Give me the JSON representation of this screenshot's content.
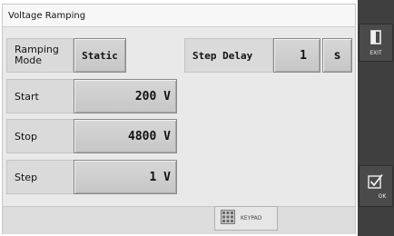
{
  "window": {
    "title": "Voltage Ramping"
  },
  "ramping_mode": {
    "label": "Ramping\nMode",
    "value": "Static"
  },
  "step_delay": {
    "label": "Step Delay",
    "value": "1",
    "unit": "s"
  },
  "start": {
    "label": "Start",
    "value": "200 V"
  },
  "stop": {
    "label": "Stop",
    "value": "4800 V"
  },
  "step": {
    "label": "Step",
    "value": "1 V"
  },
  "keypad": {
    "label": "KEYPAD",
    "icon": "keypad-icon"
  },
  "sidebar": {
    "exit_label": "EXIT",
    "exit_icon": "exit-door-icon",
    "ok_label": "OK",
    "ok_icon": "checkbox-check-icon"
  }
}
